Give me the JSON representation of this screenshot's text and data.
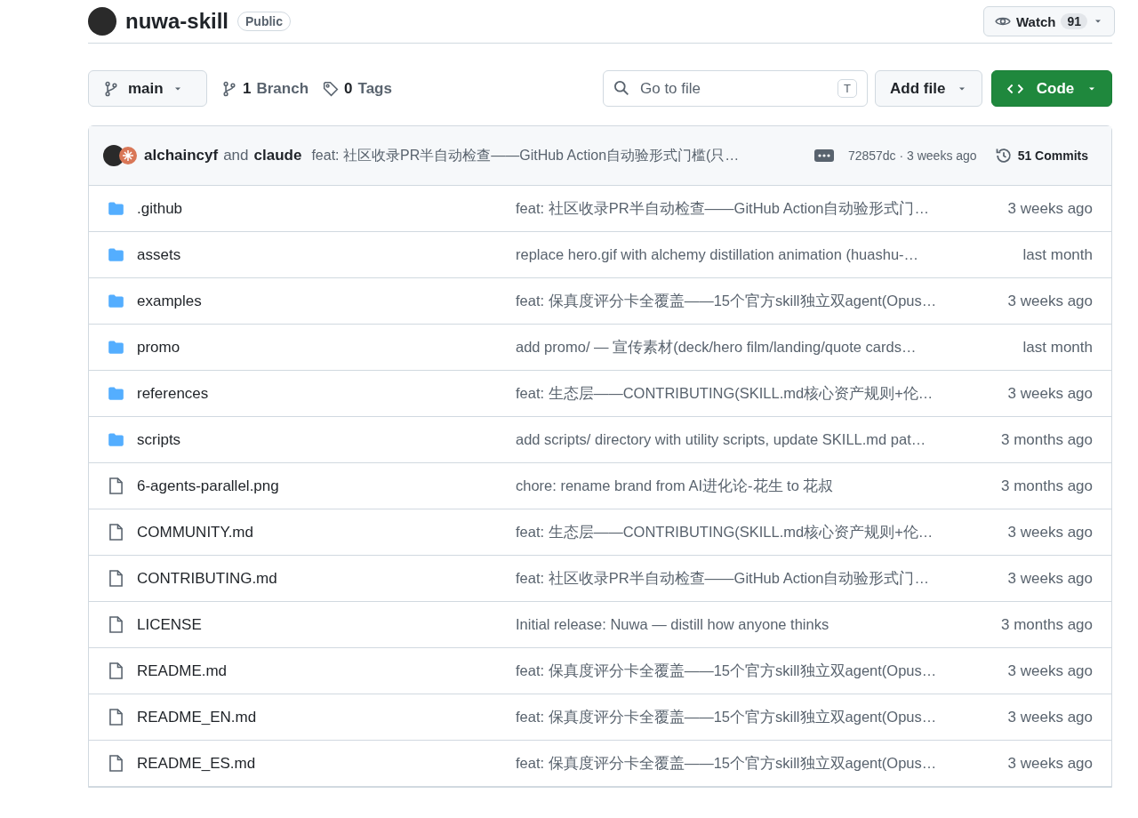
{
  "repo": {
    "name": "nuwa-skill",
    "visibility": "Public"
  },
  "watch": {
    "label": "Watch",
    "count": "91"
  },
  "toolbar": {
    "branch": "main",
    "branches": {
      "count": "1",
      "label": "Branch"
    },
    "tags": {
      "count": "0",
      "label": "Tags"
    },
    "search": {
      "placeholder": "Go to file",
      "shortcut": "T"
    },
    "add_file": "Add file",
    "code": "Code"
  },
  "latest_commit": {
    "authors": [
      "alchaincyf",
      "claude"
    ],
    "joiner": "and",
    "message": "feat: 社区收录PR半自动检查——GitHub Action自动验形式门槛(只…",
    "meta": "72857dc · 3 weeks ago",
    "commits": "51 Commits"
  },
  "files": [
    {
      "kind": "folder",
      "name": ".github",
      "message": "feat: 社区收录PR半自动检查——GitHub Action自动验形式门…",
      "age": "3 weeks ago"
    },
    {
      "kind": "folder",
      "name": "assets",
      "message": "replace hero.gif with alchemy distillation animation (huashu-…",
      "age": "last month"
    },
    {
      "kind": "folder",
      "name": "examples",
      "message": "feat: 保真度评分卡全覆盖——15个官方skill独立双agent(Opus…",
      "age": "3 weeks ago"
    },
    {
      "kind": "folder",
      "name": "promo",
      "message": "add promo/ — 宣传素材(deck/hero film/landing/quote cards…",
      "age": "last month"
    },
    {
      "kind": "folder",
      "name": "references",
      "message": "feat: 生态层——CONTRIBUTING(SKILL.md核心资产规则+伦…",
      "age": "3 weeks ago"
    },
    {
      "kind": "folder",
      "name": "scripts",
      "message": "add scripts/ directory with utility scripts, update SKILL.md pat…",
      "age": "3 months ago"
    },
    {
      "kind": "file",
      "name": "6-agents-parallel.png",
      "message": "chore: rename brand from AI进化论-花生 to 花叔",
      "age": "3 months ago"
    },
    {
      "kind": "file",
      "name": "COMMUNITY.md",
      "message": "feat: 生态层——CONTRIBUTING(SKILL.md核心资产规则+伦…",
      "age": "3 weeks ago"
    },
    {
      "kind": "file",
      "name": "CONTRIBUTING.md",
      "message": "feat: 社区收录PR半自动检查——GitHub Action自动验形式门…",
      "age": "3 weeks ago"
    },
    {
      "kind": "file",
      "name": "LICENSE",
      "message": "Initial release: Nuwa — distill how anyone thinks",
      "age": "3 months ago"
    },
    {
      "kind": "file",
      "name": "README.md",
      "message": "feat: 保真度评分卡全覆盖——15个官方skill独立双agent(Opus…",
      "age": "3 weeks ago"
    },
    {
      "kind": "file",
      "name": "README_EN.md",
      "message": "feat: 保真度评分卡全覆盖——15个官方skill独立双agent(Opus…",
      "age": "3 weeks ago"
    },
    {
      "kind": "file",
      "name": "README_ES.md",
      "message": "feat: 保真度评分卡全覆盖——15个官方skill独立双agent(Opus…",
      "age": "3 weeks ago"
    }
  ]
}
